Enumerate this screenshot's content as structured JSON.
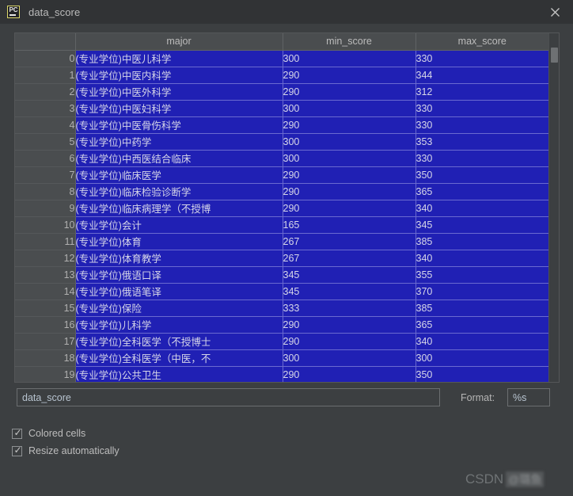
{
  "window": {
    "title": "data_score",
    "app_icon": "pycharm-icon",
    "icon_text": "PC",
    "close_icon": "close-icon"
  },
  "table": {
    "columns": [
      "major",
      "min_score",
      "max_score"
    ],
    "index_header": "",
    "rows": [
      {
        "index": "0",
        "major": "(专业学位)中医儿科学",
        "min_score": "300",
        "max_score": "330"
      },
      {
        "index": "1",
        "major": "(专业学位)中医内科学",
        "min_score": "290",
        "max_score": "344"
      },
      {
        "index": "2",
        "major": "(专业学位)中医外科学",
        "min_score": "290",
        "max_score": "312"
      },
      {
        "index": "3",
        "major": "(专业学位)中医妇科学",
        "min_score": "300",
        "max_score": "330"
      },
      {
        "index": "4",
        "major": "(专业学位)中医骨伤科学",
        "min_score": "290",
        "max_score": "330"
      },
      {
        "index": "5",
        "major": "(专业学位)中药学",
        "min_score": "300",
        "max_score": "353"
      },
      {
        "index": "6",
        "major": "(专业学位)中西医结合临床",
        "min_score": "300",
        "max_score": "330"
      },
      {
        "index": "7",
        "major": "(专业学位)临床医学",
        "min_score": "290",
        "max_score": "350"
      },
      {
        "index": "8",
        "major": "(专业学位)临床检验诊断学",
        "min_score": "290",
        "max_score": "365"
      },
      {
        "index": "9",
        "major": "(专业学位)临床病理学（不授博",
        "min_score": "290",
        "max_score": "340"
      },
      {
        "index": "10",
        "major": "(专业学位)会计",
        "min_score": "165",
        "max_score": "345"
      },
      {
        "index": "11",
        "major": "(专业学位)体育",
        "min_score": "267",
        "max_score": "385"
      },
      {
        "index": "12",
        "major": "(专业学位)体育教学",
        "min_score": "267",
        "max_score": "340"
      },
      {
        "index": "13",
        "major": "(专业学位)俄语口译",
        "min_score": "345",
        "max_score": "355"
      },
      {
        "index": "14",
        "major": "(专业学位)俄语笔译",
        "min_score": "345",
        "max_score": "370"
      },
      {
        "index": "15",
        "major": "(专业学位)保险",
        "min_score": "333",
        "max_score": "385"
      },
      {
        "index": "16",
        "major": "(专业学位)儿科学",
        "min_score": "290",
        "max_score": "365"
      },
      {
        "index": "17",
        "major": "(专业学位)全科医学（不授博士",
        "min_score": "290",
        "max_score": "340"
      },
      {
        "index": "18",
        "major": "(专业学位)全科医学（中医，不",
        "min_score": "300",
        "max_score": "300"
      },
      {
        "index": "19",
        "major": "(专业学位)公共卫生",
        "min_score": "290",
        "max_score": "350"
      }
    ]
  },
  "scrollbar": {
    "name": "vertical-scrollbar"
  },
  "form": {
    "name_value": "data_score",
    "name_placeholder": "",
    "format_label": "Format:",
    "format_value": "%s",
    "format_placeholder": ""
  },
  "options": [
    {
      "label": "Colored cells",
      "checked": "✓"
    },
    {
      "label": "Resize automatically",
      "checked": "✓"
    }
  ],
  "watermark": {
    "brand": "CSDN",
    "handle": "@璐鱼"
  },
  "colors": {
    "cell_blue": "#2020b4",
    "header_gray": "#4a4d4f",
    "window_bg": "#3c3f41",
    "titlebar": "#313335"
  }
}
